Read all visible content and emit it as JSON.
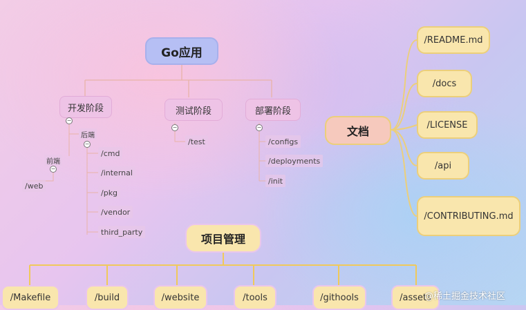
{
  "root": {
    "label": "Go应用"
  },
  "stages": {
    "dev": "开发阶段",
    "test": "测试阶段",
    "deploy": "部署阶段"
  },
  "dev": {
    "backend_label": "后端",
    "backend_items": [
      "/cmd",
      "/internal",
      "/pkg",
      "/vendor",
      "third_party"
    ],
    "frontend_label": "前端",
    "frontend_items": [
      "/web"
    ]
  },
  "test": {
    "items": [
      "/test"
    ]
  },
  "deploy": {
    "items": [
      "/configs",
      "/deployments",
      "/init"
    ]
  },
  "docs": {
    "hub": "文档",
    "items": [
      "/README.md",
      "/docs",
      "/LICENSE",
      "/api",
      "/CONTRIBUTING.md"
    ]
  },
  "project": {
    "hub": "项目管理",
    "items": [
      "/Makefile",
      "/build",
      "/website",
      "/tools",
      "/githools",
      "/assets"
    ]
  },
  "watermark": "@稀土掘金技术社区",
  "colors": {
    "root_fill": "#b6bff4",
    "stage_fill": "#eec3e6",
    "doc_fill": "#f9e6ad",
    "doc_hub_fill": "#f6c9bd",
    "connector_upper": "#e8b3a7",
    "connector_docs": "#eccf7a",
    "connector_project": "#f0c95a"
  }
}
